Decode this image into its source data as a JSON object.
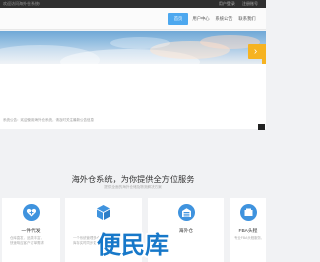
{
  "topbar": {
    "left_text": "欢迎访问海外仓系统!",
    "links": [
      "用户登录",
      "注册账号"
    ]
  },
  "header": {
    "nav": [
      {
        "label": "首页",
        "active": true
      },
      {
        "label": "用户中心",
        "active": false
      },
      {
        "label": "系统公告",
        "active": false
      },
      {
        "label": "联系我们",
        "active": false
      }
    ]
  },
  "banner": {
    "arrow": "›"
  },
  "notice": {
    "text": "系统公告：欢迎使用海外仓系统，请及时关注最新公告信息"
  },
  "section": {
    "title": "海外仓系统，为你提供全方位服务",
    "subtitle": "提供全面的海外仓储及物流解决方案"
  },
  "services": [
    {
      "icon": "heart-plus-icon",
      "title": "一件代发",
      "desc1": "仓库直发，品类丰富，",
      "desc2": "快速响应客户订单需求"
    },
    {
      "icon": "box-icon",
      "title": "",
      "desc1": "一个系统管理多仓库，",
      "desc2": "库存实时同步更新"
    },
    {
      "icon": "warehouse-icon",
      "title": "海外仓",
      "desc1": "",
      "desc2": ""
    },
    {
      "icon": "fba-icon",
      "title": "FBA头程",
      "desc1": "专业FBA头程服务，",
      "desc2": ""
    }
  ],
  "watermark": {
    "text": "便民库"
  },
  "colors": {
    "accent": "#4da8ef",
    "icon_blue": "#3f93de",
    "orange": "#f6b321",
    "watermark_blue": "#1778c9"
  }
}
